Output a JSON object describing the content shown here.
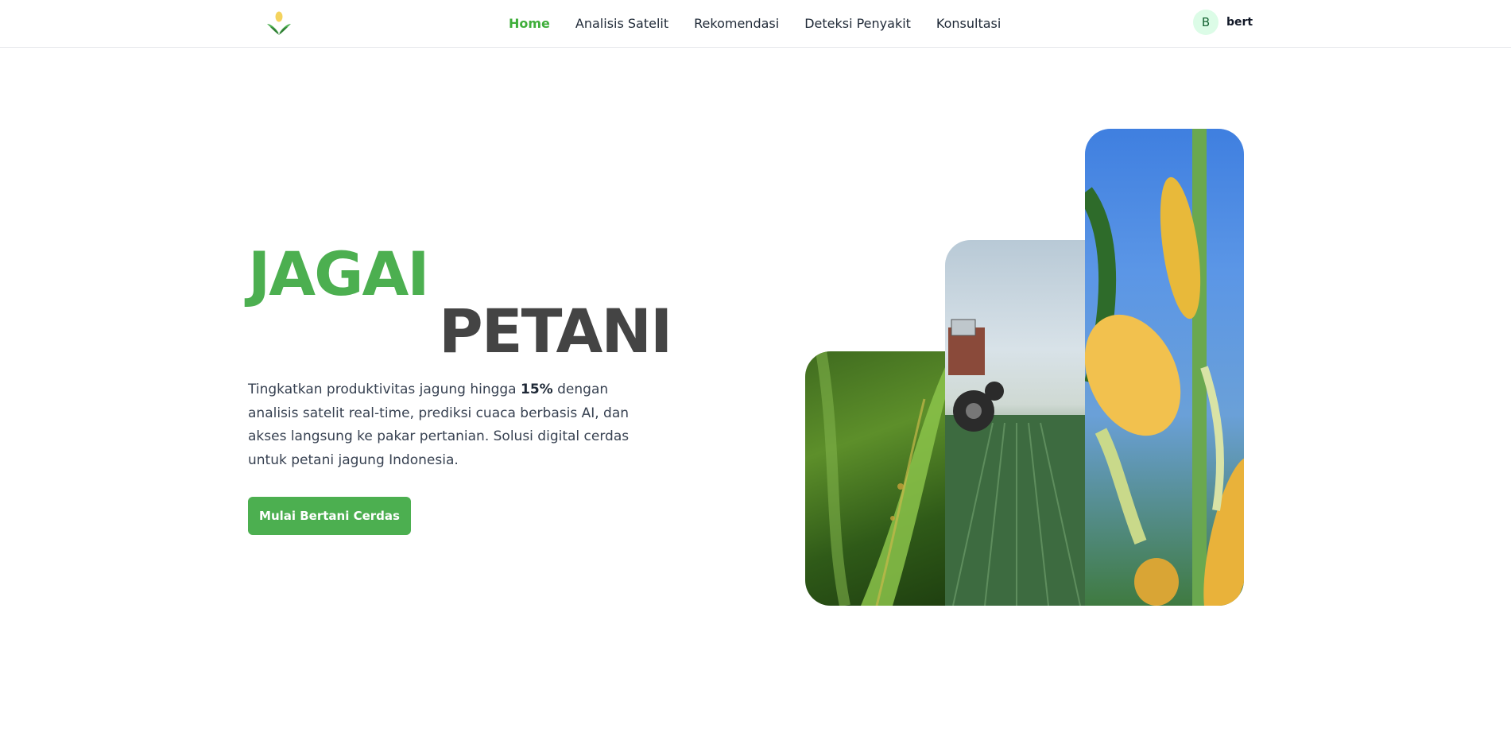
{
  "nav": {
    "items": [
      {
        "label": "Home",
        "active": true
      },
      {
        "label": "Analisis Satelit",
        "active": false
      },
      {
        "label": "Rekomendasi",
        "active": false
      },
      {
        "label": "Deteksi Penyakit",
        "active": false
      },
      {
        "label": "Konsultasi",
        "active": false
      }
    ]
  },
  "user": {
    "initial": "B",
    "name": "bert"
  },
  "hero": {
    "title_line1": "JAGAI",
    "title_line2": "PETANI",
    "description_before": "Tingkatkan produktivitas jagung hingga ",
    "description_highlight": "15%",
    "description_after": " dengan analisis satelit real-time, prediksi cuaca berbasis AI, dan akses langsung ke pakar pertanian. Solusi digital cerdas untuk petani jagung Indonesia.",
    "cta_label": "Mulai Bertani Cerdas"
  },
  "colors": {
    "brand_green": "#4caf50",
    "title_dark": "#444444",
    "avatar_bg": "#dcfce7"
  },
  "icons": {
    "logo": "corn-leaf-logo"
  },
  "images": [
    "corn-leaf-photo",
    "tractor-field-photo",
    "corn-cob-photo"
  ]
}
